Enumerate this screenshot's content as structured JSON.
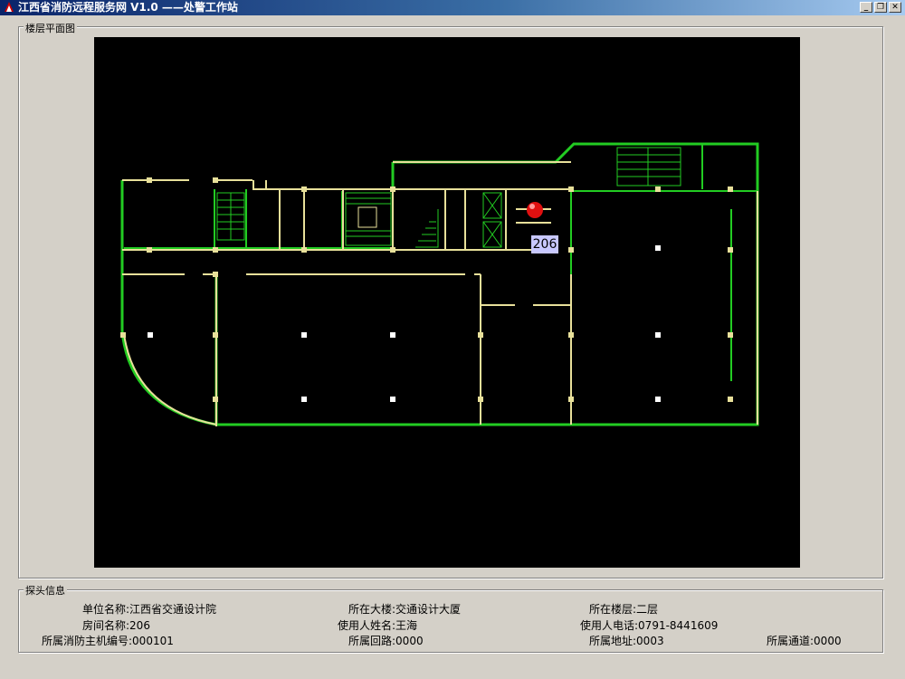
{
  "window": {
    "title": "江西省消防远程服务网 V1.0 ——处警工作站",
    "buttons": [
      "_",
      "❐",
      "✕"
    ]
  },
  "floor_plan": {
    "label": "楼层平面图",
    "room_label": "206",
    "colors": {
      "wall_green": "#22cc22",
      "wall_yellow": "#e8e09a",
      "alarm": "#e01010"
    }
  },
  "probe_info": {
    "label": "探头信息",
    "fields": [
      {
        "label": "单位名称:",
        "value": "江西省交通设计院"
      },
      {
        "label": "所在大楼:",
        "value": "交通设计大厦"
      },
      {
        "label": "所在楼层:",
        "value": "二层"
      },
      {
        "label": "房间名称:",
        "value": "206"
      },
      {
        "label": "使用人姓名:",
        "value": "王海"
      },
      {
        "label": "使用人电话:",
        "value": "0791-8441609"
      },
      {
        "label": "所属消防主机编号:",
        "value": "000101"
      },
      {
        "label": "所属回路:",
        "value": "0000"
      },
      {
        "label": "所属地址:",
        "value": "0003"
      },
      {
        "label": "所属通道:",
        "value": "0000"
      }
    ]
  }
}
